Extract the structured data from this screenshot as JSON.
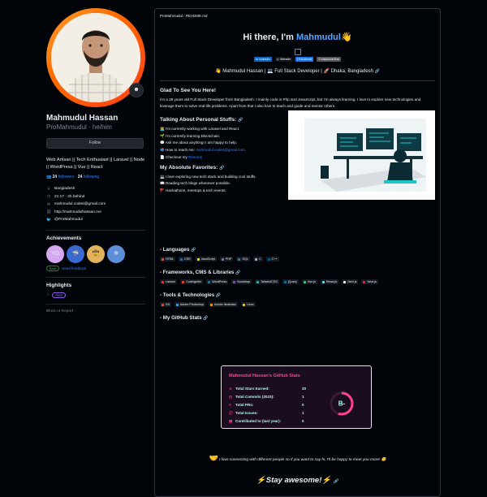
{
  "profile": {
    "name": "Mahmudul Hassan",
    "login": "ProMahmudul · he/him",
    "follow_label": "Follow",
    "bio": "Web Artisan || Tech Enthusiast || Laravel || Node || WordPress || Vue || React",
    "followers_count": "24",
    "followers_label": "followers",
    "following_count": "24",
    "following_label": "following",
    "details": [
      {
        "icon": "location-icon",
        "glyph": "⌾",
        "text": "Bangladesh"
      },
      {
        "icon": "clock-icon",
        "glyph": "◷",
        "text": "21:17 · 2h behind"
      },
      {
        "icon": "mail-icon",
        "glyph": "✉",
        "text": "mahmudul.codes@gmail.com"
      },
      {
        "icon": "link-icon",
        "glyph": "⛓",
        "text": "http://mahmudulhassan.me"
      },
      {
        "icon": "twitter-icon",
        "glyph": "🐦",
        "text": "@ProMahmudul"
      }
    ]
  },
  "achievements": {
    "title": "Achievements",
    "badges": [
      {
        "name": "yolo",
        "glyph": "YO",
        "color": "#d6a7f1"
      },
      {
        "name": "pull-shark",
        "glyph": "🦈",
        "color": "#3a6ad0"
      },
      {
        "name": "quickdraw",
        "glyph": "🤠",
        "color": "#e0b25b"
      },
      {
        "name": "arctic",
        "glyph": "❄",
        "color": "#5c8fd8"
      }
    ],
    "beta_label": "Beta",
    "feedback_label": "Send feedback"
  },
  "highlights": {
    "title": "Highlights",
    "pro_label": "PRO",
    "block_label": "Block or Report"
  },
  "readme": {
    "path_user": "ProMahmudul",
    "path_sep": " / ",
    "path_file": "README.md",
    "greeting_prefix": "Hi there, I'm ",
    "greeting_name": "Mahmudul",
    "greeting_wave": "👋",
    "socials": [
      {
        "label": "in LinkedIn",
        "color": "#0a66c2"
      },
      {
        "label": "◎ Website",
        "color": "#14161a"
      },
      {
        "label": "f Facebook",
        "color": "#1877f2"
      },
      {
        "label": "S stackoverflow",
        "color": "#555"
      }
    ],
    "tagline": "👋 Mahmudul Hassan | 💻 Full Stack Developer | 🚀 Dhaka, Bangladesh",
    "glad_title": "Glad To See You Here!",
    "glad_text": "I'm a 28 years old Full Stack Developer from Bangladesh. I mainly code in Php and JavaScript, but I'm always learning. I love to explore new technologies and leverage them to solve real-life problems. Apart from that I also love to teach and guide and mentor others.",
    "talking_title": "Talking About Personal Stuffs:",
    "talking_items": [
      "👨‍💻 I'm currently working with Laravel and React.",
      "🌱 I'm currently learning Blockchain.",
      "💬 Ask me about anything! I am happy to help.",
      "📫 How to reach me: ",
      "📄 Checkout my "
    ],
    "reach_link": "mahmudul.codes@gmail.com",
    "resume_link": "Resume",
    "favorites_title": "My Absolute Favorites:",
    "favorites_items": [
      "💻 I love exploring new tech stack and building cool stuffs.",
      "📖 Reading tech blogs whenever possible.",
      "🚩 Hackathons, meetups & tech events."
    ],
    "languages_title": "- Languages",
    "languages": [
      {
        "label": "HTML",
        "color": "#e34f26"
      },
      {
        "label": "CSS",
        "color": "#1572b6"
      },
      {
        "label": "JavaScript",
        "color": "#f7df1e"
      },
      {
        "label": "PHP",
        "color": "#777bb4"
      },
      {
        "label": "SQL",
        "color": "#4479a1"
      },
      {
        "label": "C",
        "color": "#a8b9cc"
      },
      {
        "label": "C++",
        "color": "#00599c"
      }
    ],
    "frameworks_title": "- Frameworks, CMS & Libraries",
    "frameworks": [
      {
        "label": "Laravel",
        "color": "#ff2d20"
      },
      {
        "label": "CodeIgniter",
        "color": "#ef4223"
      },
      {
        "label": "WordPress",
        "color": "#21759b"
      },
      {
        "label": "Bootstrap",
        "color": "#7952b3"
      },
      {
        "label": "TailwindCSS",
        "color": "#38b2ac"
      },
      {
        "label": "jQuery",
        "color": "#0769ad"
      },
      {
        "label": "Vue.js",
        "color": "#4fc08d"
      },
      {
        "label": "React.js",
        "color": "#61dafb"
      },
      {
        "label": "Next.js",
        "color": "#ffffff"
      },
      {
        "label": "Nest.js",
        "color": "#e0234e"
      }
    ],
    "tools_title": "- Tools & Technologies",
    "tools": [
      {
        "label": "Git",
        "color": "#f05032"
      },
      {
        "label": "Adobe Photoshop",
        "color": "#31a8ff"
      },
      {
        "label": "Adobe Illustrator",
        "color": "#ff9a00"
      },
      {
        "label": "Linux",
        "color": "#fcc624"
      }
    ],
    "stats_title": "- My GitHub Stats",
    "footer_msg": "I love connecting with different people so if you want to say hi, I'll be happy to meet you more! 😊",
    "stay_awesome": "⚡Stay awesome!⚡"
  },
  "stats_card": {
    "title": "Mahmudul Hassan's GitHub Stats",
    "rows": [
      {
        "icon": "☆",
        "label": "Total Stars Earned:",
        "value": "20"
      },
      {
        "icon": "◷",
        "label": "Total Commits (2023):",
        "value": "1"
      },
      {
        "icon": "⑂",
        "label": "Total PRs:",
        "value": "0"
      },
      {
        "icon": "ⓘ",
        "label": "Total Issues:",
        "value": "1"
      },
      {
        "icon": "▤",
        "label": "Contributed to (last year):",
        "value": "0"
      }
    ],
    "grade": "B-",
    "grade_progress": 0.55,
    "accent": "#fe428e"
  }
}
